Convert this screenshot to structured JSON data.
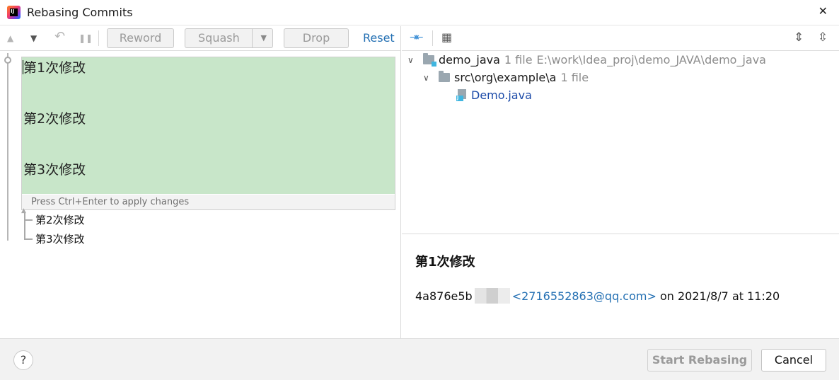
{
  "window": {
    "title": "Rebasing Commits",
    "close_glyph": "✕"
  },
  "left_toolbar": {
    "up_icon": "▲",
    "down_icon": "▼",
    "undo_icon": "↶",
    "pause_icon": "❚❚",
    "reword_label": "Reword",
    "squash_label": "Squash",
    "squash_dropdown_glyph": "▼",
    "drop_label": "Drop",
    "reset_label": "Reset"
  },
  "editor": {
    "lines": [
      "第1次修改",
      "第2次修改",
      "第3次修改"
    ],
    "hint": "Press Ctrl+Enter to apply changes"
  },
  "commits": [
    {
      "label": "第2次修改"
    },
    {
      "label": "第3次修改"
    }
  ],
  "right_toolbar": {
    "collapse_icon": "⇥⇤",
    "group_icon": "▦",
    "expand_all_icon": "⇕",
    "collapse_all_icon": "⇳"
  },
  "changes_tree": {
    "root": {
      "chevron": "∨",
      "name": "demo_java",
      "count": "1 file",
      "path": "E:\\work\\Idea_proj\\demo_JAVA\\demo_java"
    },
    "folder": {
      "chevron": "∨",
      "name": "src\\org\\example\\a",
      "count": "1 file"
    },
    "file": {
      "name": "Demo.java",
      "badge": "J"
    }
  },
  "commit_details": {
    "subject": "第1次修改",
    "hash": "4a876e5b",
    "email": "<2716552863@qq.com>",
    "date_text": "on 2021/8/7 at 11:20"
  },
  "footer": {
    "help_label": "?",
    "start_label": "Start Rebasing",
    "cancel_label": "Cancel"
  },
  "colors": {
    "editor_bg": "#c8e6c9",
    "link": "#2470b3",
    "file_link": "#1b4aa8",
    "accent_icon": "#3d8fd6"
  }
}
